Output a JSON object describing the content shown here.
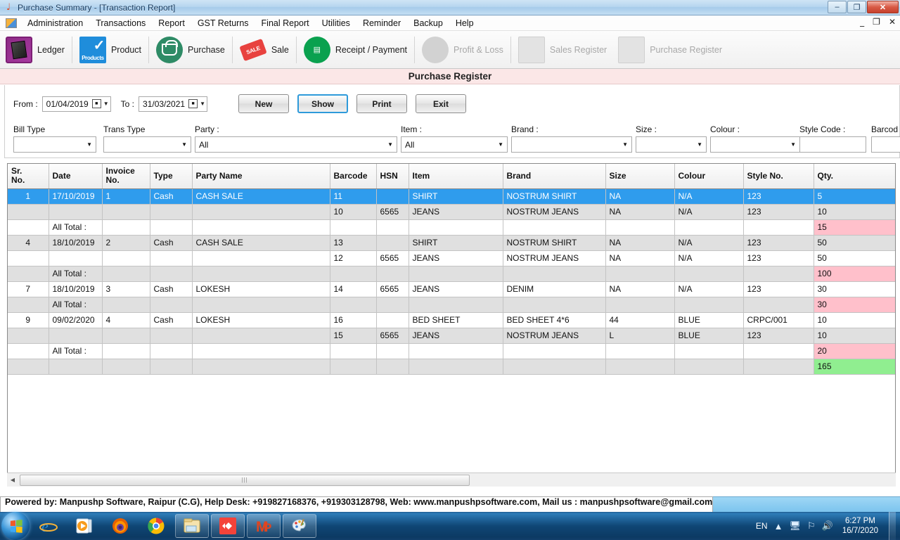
{
  "window": {
    "title": "Purchase Summary - [Transaction Report]",
    "app_icon": "mp-logo-icon",
    "minimize": "–",
    "restore": "❐",
    "close": "✕",
    "inner_minimize": "_",
    "inner_restore": "❐",
    "inner_close": "✕"
  },
  "menubar": {
    "items": [
      {
        "label": "Administration"
      },
      {
        "label": "Transactions"
      },
      {
        "label": "Report"
      },
      {
        "label": "GST Returns"
      },
      {
        "label": "Final Report"
      },
      {
        "label": "Utilities"
      },
      {
        "label": "Reminder"
      },
      {
        "label": "Backup"
      },
      {
        "label": "Help"
      }
    ]
  },
  "toolbar": {
    "items": [
      {
        "label": "Ledger",
        "icon": "ledger-icon",
        "disabled": false
      },
      {
        "label": "Product",
        "icon": "product-icon",
        "disabled": false
      },
      {
        "label": "Purchase",
        "icon": "purchase-basket-icon",
        "disabled": false
      },
      {
        "label": "Sale",
        "icon": "sale-tag-icon",
        "disabled": false
      },
      {
        "label": "Receipt / Payment",
        "icon": "receipt-payment-icon",
        "disabled": false
      },
      {
        "label": "Profit & Loss",
        "icon": "profit-loss-icon",
        "disabled": true
      },
      {
        "label": "Sales Register",
        "icon": "sales-register-icon",
        "disabled": true
      },
      {
        "label": "Purchase Register",
        "icon": "purchase-register-icon",
        "disabled": true
      }
    ],
    "product_icon_text": "Products",
    "sale_icon_text": "SALE"
  },
  "page": {
    "title": "Purchase Register"
  },
  "filters": {
    "from_label": "From :",
    "from_value": "01/04/2019",
    "to_label": "To :",
    "to_value": "31/03/2021",
    "buttons": [
      {
        "label": "New",
        "focused": false
      },
      {
        "label": "Show",
        "focused": true
      },
      {
        "label": "Print",
        "focused": false
      },
      {
        "label": "Exit",
        "focused": false
      }
    ],
    "fields": [
      {
        "label": "Bill Type",
        "value": "",
        "type": "select"
      },
      {
        "label": "Trans Type",
        "value": "",
        "type": "select"
      },
      {
        "label": "Party :",
        "value": "All",
        "type": "select"
      },
      {
        "label": "Item :",
        "value": "All",
        "type": "select"
      },
      {
        "label": "Brand :",
        "value": "",
        "type": "select"
      },
      {
        "label": "Size :",
        "value": "",
        "type": "select"
      },
      {
        "label": "Colour :",
        "value": "",
        "type": "select"
      },
      {
        "label": "Style Code :",
        "value": "",
        "type": "text"
      },
      {
        "label": "Barcod",
        "value": "",
        "type": "text"
      }
    ]
  },
  "grid": {
    "columns": [
      "Sr.\nNo.",
      "Date",
      "Invoice\nNo.",
      "Type",
      "Party Name",
      "Barcode",
      "HSN",
      "Item",
      "Brand",
      "Size",
      "Colour",
      "Style No.",
      "Qty."
    ],
    "rows": [
      {
        "style": "selected",
        "cells": [
          "1",
          "17/10/2019",
          "1",
          "Cash",
          "CASH SALE",
          "11",
          "",
          "SHIRT",
          "NOSTRUM SHIRT",
          "NA",
          "N/A",
          "123",
          "5"
        ]
      },
      {
        "style": "alt",
        "cells": [
          "",
          "",
          "",
          "",
          "",
          "10",
          "6565",
          "JEANS",
          "NOSTRUM JEANS",
          "NA",
          "N/A",
          "123",
          "10"
        ]
      },
      {
        "style": "white",
        "cells": [
          "",
          "All Total :",
          "",
          "",
          "",
          "",
          "",
          "",
          "",
          "",
          "",
          "",
          ""
        ],
        "qty": "15",
        "qty_style": "pink"
      },
      {
        "style": "alt",
        "cells": [
          "4",
          "18/10/2019",
          "2",
          "Cash",
          "CASH SALE",
          "13",
          "",
          "SHIRT",
          "NOSTRUM SHIRT",
          "NA",
          "N/A",
          "123",
          "50"
        ]
      },
      {
        "style": "white",
        "cells": [
          "",
          "",
          "",
          "",
          "",
          "12",
          "6565",
          "JEANS",
          "NOSTRUM JEANS",
          "NA",
          "N/A",
          "123",
          "50"
        ]
      },
      {
        "style": "alt",
        "cells": [
          "",
          "All Total :",
          "",
          "",
          "",
          "",
          "",
          "",
          "",
          "",
          "",
          "",
          ""
        ],
        "qty": "100",
        "qty_style": "pink"
      },
      {
        "style": "white",
        "cells": [
          "7",
          "18/10/2019",
          "3",
          "Cash",
          "LOKESH",
          "14",
          "6565",
          "JEANS",
          "DENIM",
          "NA",
          "N/A",
          "123",
          "30"
        ]
      },
      {
        "style": "alt",
        "cells": [
          "",
          "All Total :",
          "",
          "",
          "",
          "",
          "",
          "",
          "",
          "",
          "",
          "",
          ""
        ],
        "qty": "30",
        "qty_style": "pink"
      },
      {
        "style": "white",
        "cells": [
          "9",
          "09/02/2020",
          "4",
          "Cash",
          "LOKESH",
          "16",
          "",
          "BED SHEET",
          "BED SHEET 4*6",
          "44",
          "BLUE",
          "CRPC/001",
          "10"
        ]
      },
      {
        "style": "alt",
        "cells": [
          "",
          "",
          "",
          "",
          "",
          "15",
          "6565",
          "JEANS",
          "NOSTRUM JEANS",
          "L",
          "BLUE",
          "123",
          "10"
        ]
      },
      {
        "style": "white",
        "cells": [
          "",
          "All Total :",
          "",
          "",
          "",
          "",
          "",
          "",
          "",
          "",
          "",
          "",
          ""
        ],
        "qty": "20",
        "qty_style": "pink"
      },
      {
        "style": "alt",
        "cells": [
          "",
          "",
          "",
          "",
          "",
          "",
          "",
          "",
          "",
          "",
          "",
          "",
          ""
        ],
        "qty": "165",
        "qty_style": "green"
      }
    ]
  },
  "scrollbar": {
    "left_arrow": "◀",
    "thumb_grip": "|||"
  },
  "footer": {
    "text": "Powered by: Manpushp Software, Raipur (C.G), Help Desk: +919827168376, +919303128798, Web: www.manpushpsoftware.com,  Mail us :  manpushpsoftware@gmail.com"
  },
  "taskbar": {
    "start": "start-orb-icon",
    "buttons": [
      {
        "name": "internet-explorer-icon",
        "pinned": false
      },
      {
        "name": "media-player-icon",
        "pinned": false
      },
      {
        "name": "firefox-icon",
        "pinned": false
      },
      {
        "name": "chrome-icon",
        "pinned": false
      },
      {
        "name": "file-explorer-icon",
        "pinned": true
      },
      {
        "name": "red-app-icon",
        "pinned": true
      },
      {
        "name": "manpushp-app-icon",
        "pinned": true
      },
      {
        "name": "paint-icon",
        "pinned": true
      }
    ],
    "tray": {
      "language": "EN",
      "show_hidden": "▲",
      "network": "network-icon",
      "action_flag": "flag-icon",
      "volume": "volume-icon",
      "time": "6:27 PM",
      "date": "16/7/2020"
    }
  },
  "colors": {
    "selection_blue": "#2f9ced",
    "total_pink": "#ffc0cb",
    "grand_total_green": "#90ee90",
    "title_band": "#fbe7e7",
    "footer_blue": "#7cc4ee"
  }
}
